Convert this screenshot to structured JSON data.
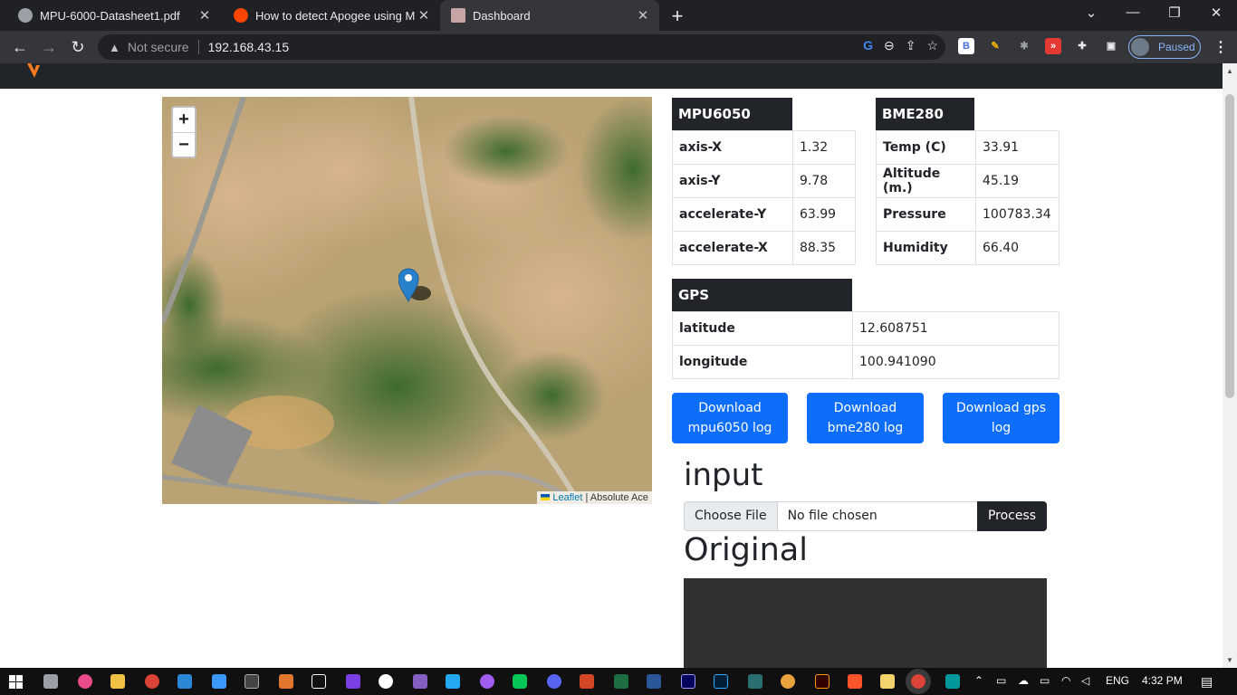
{
  "browser": {
    "tabs": [
      {
        "title": "MPU-6000-Datasheet1.pdf",
        "icon": "globe-icon"
      },
      {
        "title": "How to detect Apogee using MPU",
        "icon": "reddit-icon"
      },
      {
        "title": "Dashboard",
        "icon": "page-icon"
      }
    ],
    "not_secure": "Not secure",
    "url": "192.168.43.15",
    "profile_status": "Paused"
  },
  "map": {
    "zoom_in": "+",
    "zoom_out": "−",
    "attribution_link": "Leaflet",
    "attribution_sep": " | ",
    "attribution_text": "Absolute Ace"
  },
  "mpu6050": {
    "title": "MPU6050",
    "rows": [
      {
        "label": "axis-X",
        "value": "1.32"
      },
      {
        "label": "axis-Y",
        "value": "9.78"
      },
      {
        "label": "accelerate-Y",
        "value": "63.99"
      },
      {
        "label": "accelerate-X",
        "value": "88.35"
      }
    ]
  },
  "bme280": {
    "title": "BME280",
    "rows": [
      {
        "label": "Temp (C)",
        "value": "33.91"
      },
      {
        "label": "Altitude (m.)",
        "value": "45.19"
      },
      {
        "label": "Pressure",
        "value": "100783.34"
      },
      {
        "label": "Humidity",
        "value": "66.40"
      }
    ]
  },
  "gps": {
    "title": "GPS",
    "rows": [
      {
        "label": "latitude",
        "value": "12.608751"
      },
      {
        "label": "longitude",
        "value": "100.941090"
      }
    ]
  },
  "downloads": {
    "mpu": "Download mpu6050 log",
    "bme": "Download bme280 log",
    "gps": "Download gps log"
  },
  "upload": {
    "heading": "input",
    "choose_label": "Choose File",
    "file_status": "No file chosen",
    "process_label": "Process"
  },
  "original": {
    "heading": "Original"
  },
  "taskbar": {
    "lang": "ENG",
    "time": "4:32 PM"
  }
}
